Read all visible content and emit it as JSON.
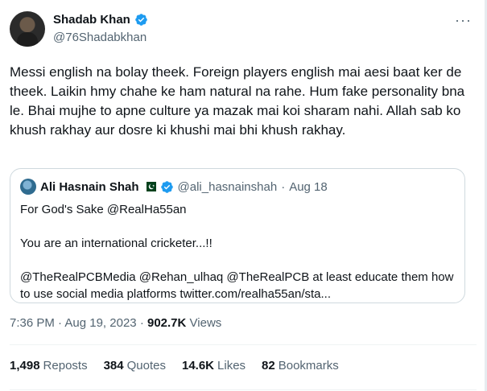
{
  "author": {
    "display_name": "Shadab Khan",
    "handle": "@76Shadabkhan",
    "verified": true
  },
  "tweet": {
    "text": "Messi english na bolay theek. Foreign players english mai aesi baat ker de theek. Laikin hmy chahe ke ham natural na rahe. Hum fake personality bna le. Bhai mujhe to apne culture ya mazak mai koi sharam nahi. Allah sab ko khush rakhay aur dosre ki khushi mai bhi khush rakhay."
  },
  "quote": {
    "display_name": "Ali Hasnain Shah",
    "handle": "@ali_hasnainshah",
    "date": "Aug 18",
    "separator": "·",
    "lines": [
      "For God's Sake @RealHa55an",
      "",
      "You are an international cricketer...!!",
      "",
      "@TheRealPCBMedia @Rehan_ulhaq @TheRealPCB at least educate them how to use social media platforms twitter.com/realha55an/sta..."
    ]
  },
  "meta": {
    "time": "7:36 PM",
    "date": "Aug 19, 2023",
    "separator": "·",
    "views_count": "902.7K",
    "views_label": "Views"
  },
  "stats": [
    {
      "count": "1,498",
      "label": "Reposts"
    },
    {
      "count": "384",
      "label": "Quotes"
    },
    {
      "count": "14.6K",
      "label": "Likes"
    },
    {
      "count": "82",
      "label": "Bookmarks"
    }
  ],
  "colors": {
    "verified_blue": "#1d9bf0",
    "secondary_text": "#536471",
    "primary_text": "#0f1419",
    "border": "#cfd9de"
  },
  "icons": {
    "verified": "verified-badge-icon",
    "more": "more-options-icon",
    "flag": "pakistan-flag-icon"
  }
}
